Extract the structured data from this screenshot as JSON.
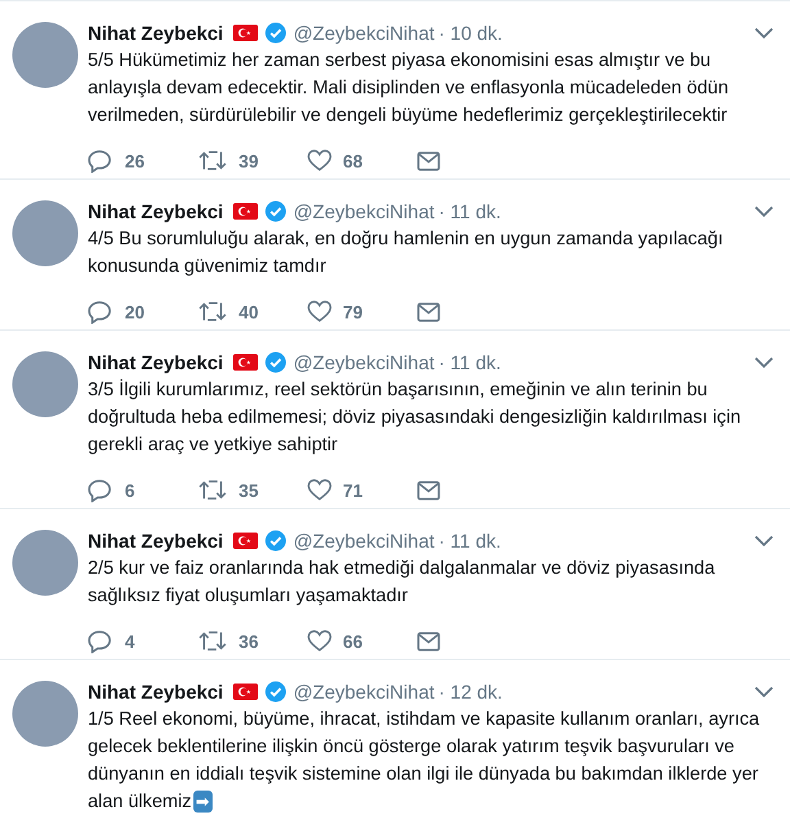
{
  "tweets": [
    {
      "name": "Nihat Zeybekci",
      "handle": "@ZeybekciNihat",
      "time": "· 10 dk.",
      "text": "5/5 Hükümetimiz her zaman serbest piyasa ekonomisini esas almıştır ve bu anlayışla devam edecektir. Mali disiplinden ve enflasyonla mücadeleden ödün verilmeden, sürdürülebilir ve dengeli büyüme hedeflerimiz gerçekleştirilecektir",
      "verified": true,
      "replies": "26",
      "retweets": "39",
      "likes": "68"
    },
    {
      "name": "Nihat Zeybekci",
      "handle": "@ZeybekciNihat",
      "time": "· 11 dk.",
      "text": "4/5 Bu sorumluluğu alarak, en doğru hamlenin en uygun zamanda yapılacağı konusunda güvenimiz tamdır",
      "verified": true,
      "replies": "20",
      "retweets": "40",
      "likes": "79"
    },
    {
      "name": "Nihat Zeybekci",
      "handle": "@ZeybekciNihat",
      "time": "· 11 dk.",
      "text": "3/5 İlgili kurumlarımız, reel sektörün başarısının, emeğinin ve alın terinin bu doğrultuda heba edilmemesi; döviz piyasasındaki dengesizliğin kaldırılması için gerekli araç ve yetkiye sahiptir",
      "verified": true,
      "replies": "6",
      "retweets": "35",
      "likes": "71"
    },
    {
      "name": "Nihat Zeybekci",
      "handle": "@ZeybekciNihat",
      "time": "· 11 dk.",
      "text": "2/5 kur ve faiz oranlarında hak etmediği dalgalanmalar ve döviz piyasasında sağlıksız fiyat oluşumları yaşamaktadır",
      "verified": true,
      "replies": "4",
      "retweets": "36",
      "likes": "66"
    },
    {
      "name": "Nihat Zeybekci",
      "handle": "@ZeybekciNihat",
      "time": "· 12 dk.",
      "text": "1/5 Reel ekonomi, büyüme, ihracat, istihdam ve kapasite kullanım oranları, ayrıca gelecek beklentilerine ilişkin öncü gösterge olarak yatırım teşvik başvuruları ve dünyanın en iddialı teşvik sistemine olan ilgi ile dünyada bu bakımdan ilklerde yer alan ülkemiz",
      "emoji": "➡",
      "verified": true
    }
  ]
}
